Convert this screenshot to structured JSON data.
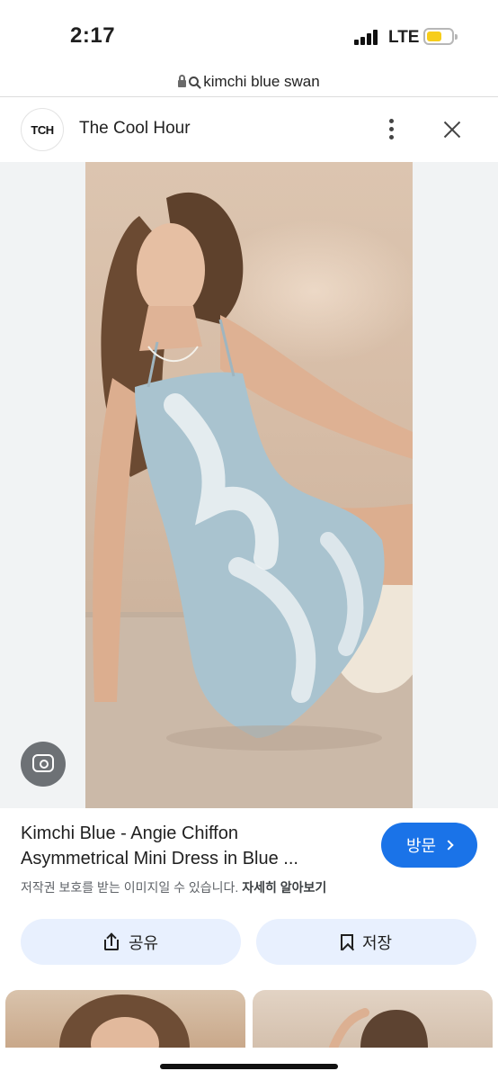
{
  "status_bar": {
    "time": "2:17",
    "network": "LTE",
    "battery_color": "#f7cd1a"
  },
  "url_bar": {
    "query": "kimchi blue swan"
  },
  "header": {
    "avatar_text": "TCH",
    "source_name": "The Cool Hour"
  },
  "result": {
    "title_line1": "Kimchi Blue - Angie Chiffon",
    "title_line2": "Asymmetrical Mini Dress in Blue ...",
    "visit_label": "방문",
    "copyright_text": "저작권 보호를 받는 이미지일 수 있습니다.",
    "learn_more": "자세히 알아보기"
  },
  "actions": {
    "share_label": "공유",
    "save_label": "저장"
  },
  "colors": {
    "accent": "#1a73e8",
    "action_bg": "#e8f0fe",
    "image_bg": "#f1f3f4"
  }
}
